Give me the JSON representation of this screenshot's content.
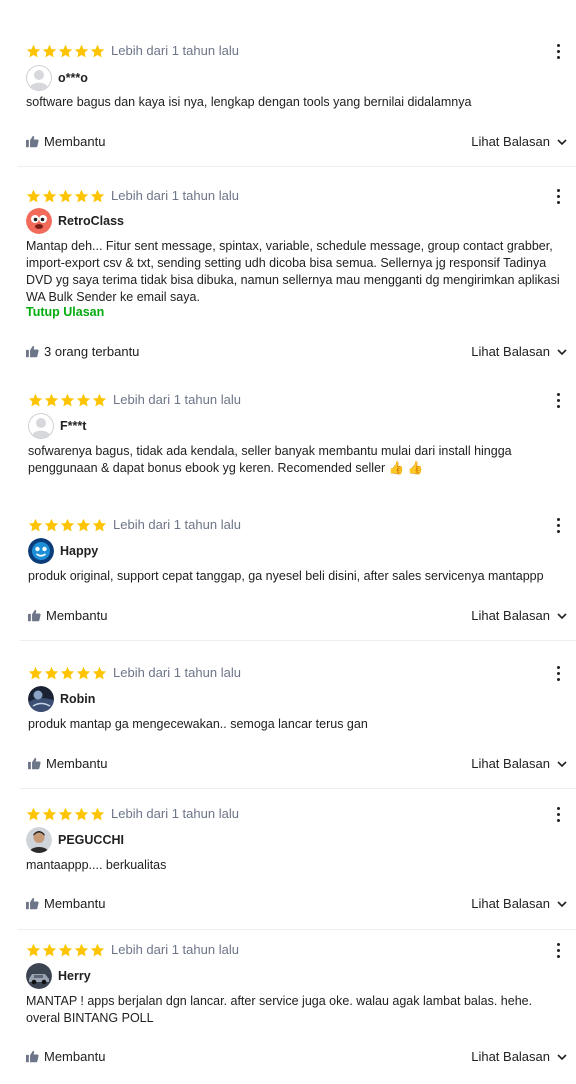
{
  "star_color": "#ffc400",
  "accent_color": "#03ac0e",
  "reviews": [
    {
      "rating": 5,
      "date": "Lebih dari 1 tahun lalu",
      "user": "o***o",
      "avatar": "default",
      "text": "software bagus dan kaya isi nya, lengkap dengan tools yang bernilai didalamnya",
      "helpful": "Membantu",
      "replies": "Lihat Balasan"
    },
    {
      "rating": 5,
      "date": "Lebih dari 1 tahun lalu",
      "user": "RetroClass",
      "avatar": "retro",
      "text": "Mantap deh... Fitur sent message, spintax, variable, schedule message, group contact grabber, import-export csv & txt, sending setting udh dicoba bisa semua. Sellernya jg responsif Tadinya DVD yg saya terima tidak bisa dibuka, namun sellernya mau mengganti dg mengirimkan aplikasi WA Bulk Sender ke email saya.",
      "toggle": "Tutup Ulasan",
      "helpful": "3 orang terbantu",
      "replies": "Lihat Balasan"
    },
    {
      "rating": 5,
      "date": "Lebih dari 1 tahun lalu",
      "user": "F***t",
      "avatar": "default",
      "text": "sofwarenya bagus, tidak ada kendala, seller banyak membantu mulai dari install hingga penggunaan & dapat bonus ebook yg keren. Recomended seller 👍 👍"
    },
    {
      "rating": 5,
      "date": "Lebih dari 1 tahun lalu",
      "user": "Happy",
      "avatar": "happy",
      "text": "produk original, support cepat tanggap, ga nyesel beli disini, after sales servicenya mantappp",
      "helpful": "Membantu",
      "replies": "Lihat Balasan"
    },
    {
      "rating": 5,
      "date": "Lebih dari 1 tahun lalu",
      "user": "Robin",
      "avatar": "robin",
      "text": "produk mantap ga mengecewakan.. semoga lancar terus gan",
      "helpful": "Membantu",
      "replies": "Lihat Balasan"
    },
    {
      "rating": 5,
      "date": "Lebih dari 1 tahun lalu",
      "user": "PEGUCCHI",
      "avatar": "person",
      "text": "mantaappp.... berkualitas",
      "helpful": "Membantu",
      "replies": "Lihat Balasan"
    },
    {
      "rating": 5,
      "date": "Lebih dari 1 tahun lalu",
      "user": "Herry",
      "avatar": "car",
      "text": "MANTAP ! apps berjalan dgn lancar. after service juga oke. walau agak lambat balas. hehe. overal BINTANG POLL",
      "helpful": "Membantu",
      "replies": "Lihat Balasan"
    }
  ]
}
